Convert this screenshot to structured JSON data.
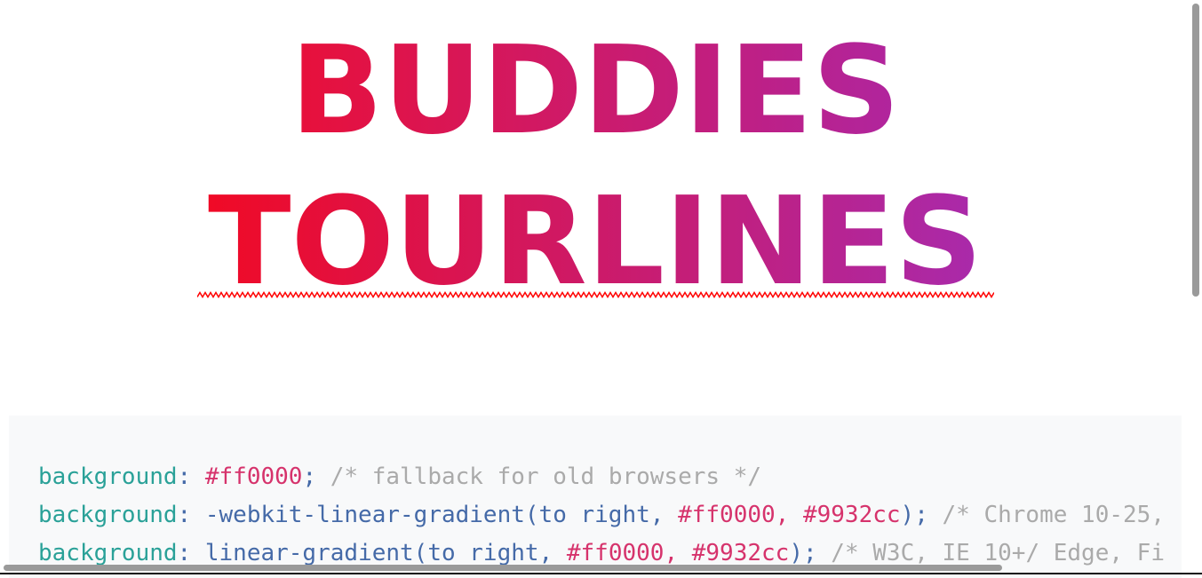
{
  "heading": {
    "line1": "BUDDIES",
    "line2": "TOURLINES"
  },
  "colors": {
    "gradient_start": "#ff0000",
    "gradient_end": "#9932cc",
    "spellcheck_underline": "#ff0000",
    "code_background": "#f8f9fa"
  },
  "code": {
    "lines": [
      {
        "prop": "background",
        "colon": ":",
        "value_func": "",
        "value_hex1": "#ff0000",
        "value_sep": "",
        "value_hex2": "",
        "close": "",
        "semicolon": ";",
        "comment": "/* fallback for old browsers */"
      },
      {
        "prop": "background",
        "colon": ":",
        "value_func": "-webkit-linear-gradient(to right, ",
        "value_hex1": "#ff0000",
        "value_sep": ", ",
        "value_hex2": "#9932cc",
        "close": ")",
        "semicolon": ";",
        "comment": "/* Chrome 10-25,"
      },
      {
        "prop": "background",
        "colon": ":",
        "value_func": "linear-gradient(to right, ",
        "value_hex1": "#ff0000",
        "value_sep": ", ",
        "value_hex2": "#9932cc",
        "close": ")",
        "semicolon": ";",
        "comment": "/* W3C, IE 10+/ Edge, Fi"
      }
    ]
  }
}
